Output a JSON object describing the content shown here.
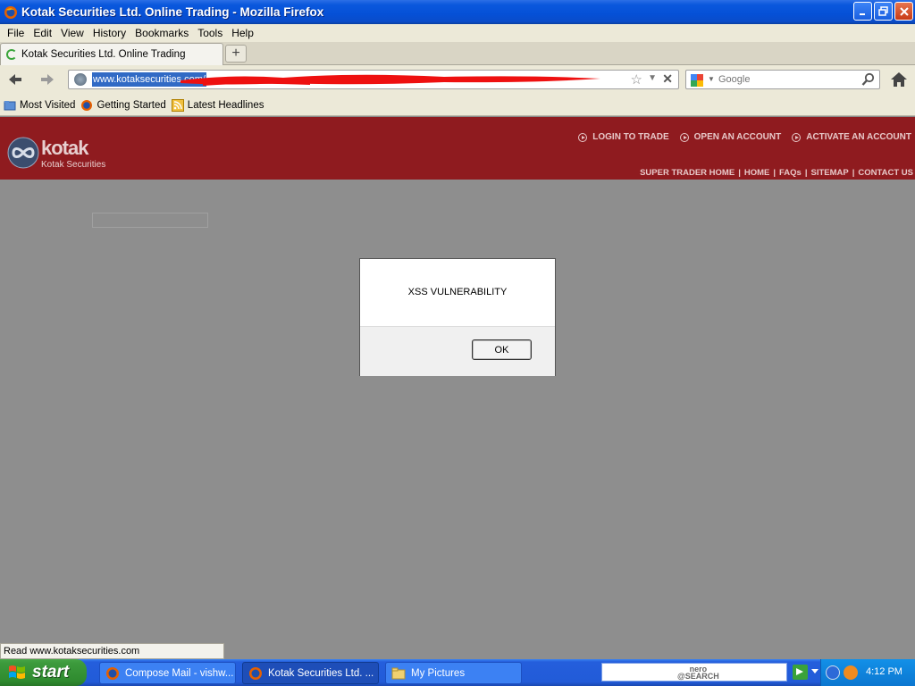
{
  "window": {
    "title": "Kotak Securities Ltd. Online Trading - Mozilla Firefox"
  },
  "menu": [
    "File",
    "Edit",
    "View",
    "History",
    "Bookmarks",
    "Tools",
    "Help"
  ],
  "tab": {
    "title": "Kotak Securities Ltd. Online Trading",
    "new_tab_symbol": "+"
  },
  "address": {
    "url": "www.kotaksecurities.com/"
  },
  "search": {
    "placeholder": "Google"
  },
  "bookmarks": [
    "Most Visited",
    "Getting Started",
    "Latest Headlines"
  ],
  "site": {
    "logo_word": "kotak",
    "logo_sub": "Kotak Securities",
    "top_links": [
      "LOGIN TO TRADE",
      "OPEN AN ACCOUNT",
      "ACTIVATE AN ACCOUNT"
    ],
    "sub_links": [
      "SUPER TRADER HOME",
      "HOME",
      "FAQs",
      "SITEMAP",
      "CONTACT US"
    ],
    "separator": "|",
    "brand_color": "#8f1b1f"
  },
  "dialog": {
    "message": "XSS VULNERABILITY",
    "ok_label": "OK"
  },
  "status": {
    "text": "Read www.kotaksecurities.com"
  },
  "taskbar": {
    "start_label": "start",
    "items": [
      "Compose Mail - vishw...",
      "Kotak Securities Ltd. ...",
      "My Pictures"
    ],
    "nero_logo": "nero\n@SEARCH",
    "clock": "4:12 PM"
  }
}
